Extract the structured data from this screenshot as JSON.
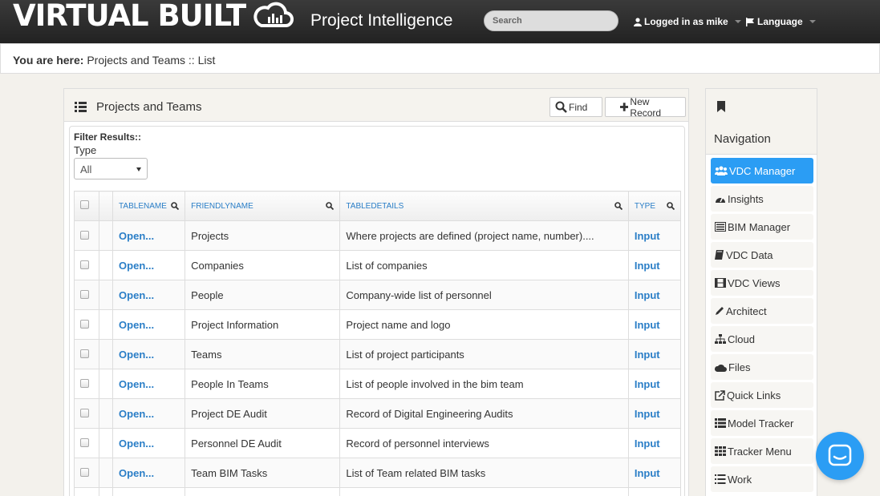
{
  "header": {
    "logo_text": "VIRTUAL BUILT",
    "app_title": "Project Intelligence",
    "search_placeholder": "Search",
    "user_menu": "Logged in as mike",
    "language_menu": "Language"
  },
  "breadcrumb": {
    "prefix": "You are here:",
    "path": "Projects and Teams :: List"
  },
  "panel": {
    "title": "Projects and Teams",
    "find_label": "Find",
    "new_record_label": "New Record",
    "filter_title": "Filter Results::",
    "filter_label": "Type",
    "filter_value": "All"
  },
  "table": {
    "columns": [
      "TABLENAME",
      "FRIENDLYNAME",
      "TABLEDETAILS",
      "TYPE"
    ],
    "rows": [
      {
        "open": "Open...",
        "friendly": "Projects",
        "details": "Where projects are defined (project name, number)....",
        "type": "Input"
      },
      {
        "open": "Open...",
        "friendly": "Companies",
        "details": "List of companies",
        "type": "Input"
      },
      {
        "open": "Open...",
        "friendly": "People",
        "details": "Company-wide list of personnel",
        "type": "Input"
      },
      {
        "open": "Open...",
        "friendly": "Project Information",
        "details": "Project name and logo",
        "type": "Input"
      },
      {
        "open": "Open...",
        "friendly": "Teams",
        "details": "List of project participants",
        "type": "Input"
      },
      {
        "open": "Open...",
        "friendly": "People In Teams",
        "details": "List of people involved in the bim team",
        "type": "Input"
      },
      {
        "open": "Open...",
        "friendly": "Project DE Audit",
        "details": "Record of Digital Engineering Audits",
        "type": "Input"
      },
      {
        "open": "Open...",
        "friendly": "Personnel DE Audit",
        "details": "Record of personnel interviews",
        "type": "Input"
      },
      {
        "open": "Open...",
        "friendly": "Team BIM Tasks",
        "details": "List of Team related BIM tasks",
        "type": "Input"
      }
    ]
  },
  "navigation": {
    "title": "Navigation",
    "items": [
      {
        "label": "VDC Manager",
        "icon": "users-icon",
        "active": true
      },
      {
        "label": "Insights",
        "icon": "dashboard-icon",
        "active": false
      },
      {
        "label": "BIM Manager",
        "icon": "list-alt-icon",
        "active": false
      },
      {
        "label": "VDC Data",
        "icon": "book-icon",
        "active": false
      },
      {
        "label": "VDC Views",
        "icon": "film-icon",
        "active": false
      },
      {
        "label": "Architect",
        "icon": "pencil-icon",
        "active": false
      },
      {
        "label": "Cloud",
        "icon": "sitemap-icon",
        "active": false
      },
      {
        "label": "Files",
        "icon": "cloud-icon",
        "active": false
      },
      {
        "label": "Quick Links",
        "icon": "external-link-icon",
        "active": false
      },
      {
        "label": "Model Tracker",
        "icon": "th-list-icon",
        "active": false
      },
      {
        "label": "Tracker Menu",
        "icon": "th-icon",
        "active": false
      },
      {
        "label": "Work",
        "icon": "list-icon",
        "active": false
      }
    ]
  },
  "colors": {
    "accent": "#2b9df4",
    "link": "#2a7ec7",
    "topbar": "#2b2b2b"
  }
}
